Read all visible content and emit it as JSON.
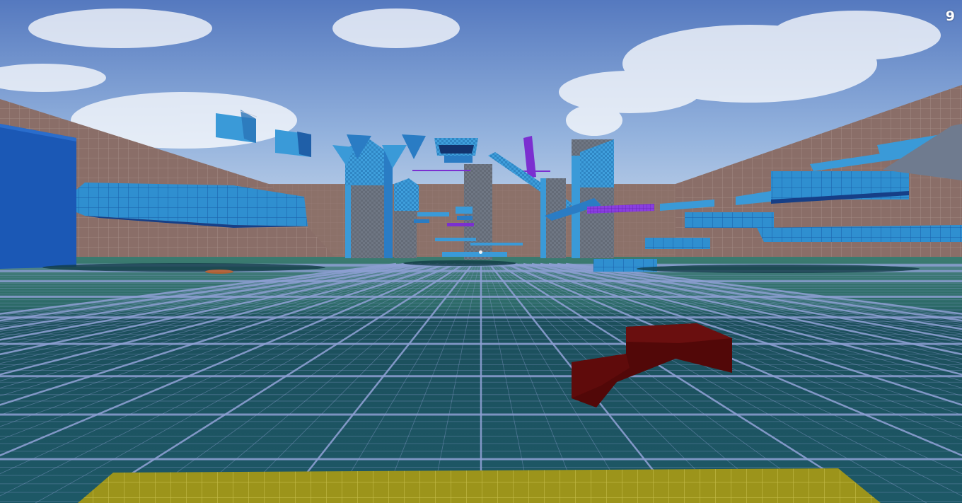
{
  "hud": {
    "counter": "9"
  },
  "colors": {
    "sky_top": "#5d86c6",
    "sky_bottom": "#c7d8ee",
    "wall_brown": "#8a6f68",
    "floor_far": "#2e6b68",
    "floor_near": "#1f5660",
    "grid_line": "#8d9fd2",
    "platform_blue": "#3a98d4",
    "platform_dark": "#14468f",
    "pillar_gray": "#6b7280",
    "accent_purple": "#7b2fd0",
    "arrow_red": "#5c0a0a",
    "pad_yellow": "#a59a1c"
  },
  "icons": {
    "crosshair": "crosshair-icon",
    "direction_arrow": "arrow-icon"
  }
}
